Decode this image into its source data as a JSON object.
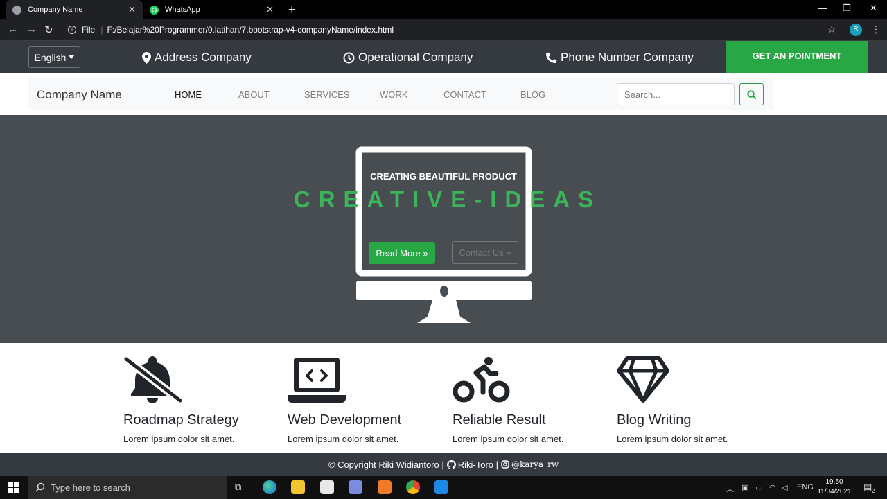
{
  "browser": {
    "tabs": [
      {
        "title": "Company Name"
      },
      {
        "title": "WhatsApp"
      }
    ],
    "url_scheme": "File",
    "url": "F:/Belajar%20Programmer/0.latihan/7.bootstrap-v4-companyName/index.html",
    "profile_initial": "R"
  },
  "topbar": {
    "language": "English",
    "address": "Address Company",
    "operational": "Operational Company",
    "phone": "Phone Number Company",
    "appointment": "GET AN POINTMENT"
  },
  "navbar": {
    "brand": "Company Name",
    "links": [
      "HOME",
      "ABOUT",
      "SERVICES",
      "WORK",
      "CONTACT",
      "BLOG"
    ],
    "search_placeholder": "Search..."
  },
  "hero": {
    "subtitle": "CREATING BEAUTIFUL PRODUCT",
    "title": "CREATIVE-IDEAS",
    "read_more": "Read More »",
    "contact_us": "Contact Us »"
  },
  "features": [
    {
      "icon": "bell-slash-icon",
      "title": "Roadmap Strategy",
      "text": "Lorem ipsum dolor sit amet."
    },
    {
      "icon": "laptop-code-icon",
      "title": "Web Development",
      "text": "Lorem ipsum dolor sit amet."
    },
    {
      "icon": "biking-icon",
      "title": "Reliable Result",
      "text": "Lorem ipsum dolor sit amet."
    },
    {
      "icon": "gem-icon",
      "title": "Blog Writing",
      "text": "Lorem ipsum dolor sit amet."
    }
  ],
  "footer": {
    "copyright": "© Copyright Riki Widiantoro |",
    "github": "Riki-Toro |",
    "instagram": "@karya_rw"
  },
  "taskbar": {
    "search_placeholder": "Type here to search",
    "language": "ENG",
    "time": "19.50",
    "date": "11/04/2021",
    "notifications": "2"
  },
  "colors": {
    "accent": "#28a745",
    "topbar": "#343a40",
    "hero": "#484d52"
  }
}
